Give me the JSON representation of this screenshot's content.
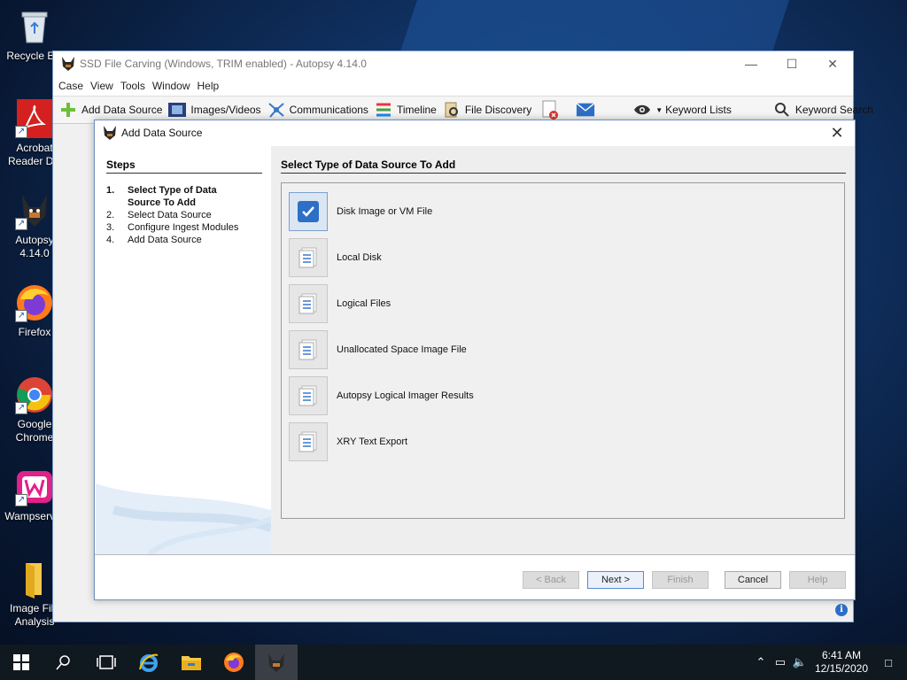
{
  "desktop": {
    "icons": [
      {
        "label": "Recycle Bin"
      },
      {
        "label": "Acrobat Reader DC"
      },
      {
        "label": "Autopsy 4.14.0"
      },
      {
        "label": "Firefox"
      },
      {
        "label": "Google Chrome"
      },
      {
        "label": "Wampserver"
      },
      {
        "label": "Image File Analysis"
      }
    ]
  },
  "window": {
    "title": "SSD File Carving (Windows, TRIM enabled) - Autopsy 4.14.0",
    "menu": [
      "Case",
      "View",
      "Tools",
      "Window",
      "Help"
    ],
    "toolbar": {
      "add_data_source": "Add Data Source",
      "images_videos": "Images/Videos",
      "communications": "Communications",
      "timeline": "Timeline",
      "file_discovery": "File Discovery",
      "keyword_lists": "Keyword Lists",
      "keyword_search": "Keyword Search"
    }
  },
  "dialog": {
    "title": "Add Data Source",
    "steps_heading": "Steps",
    "steps": [
      {
        "num": "1.",
        "label": "Select Type of Data Source To Add"
      },
      {
        "num": "2.",
        "label": "Select Data Source"
      },
      {
        "num": "3.",
        "label": "Configure Ingest Modules"
      },
      {
        "num": "4.",
        "label": "Add Data Source"
      }
    ],
    "content_heading": "Select Type of Data Source To Add",
    "options": [
      {
        "label": "Disk Image or VM File",
        "selected": true
      },
      {
        "label": "Local Disk"
      },
      {
        "label": "Logical Files"
      },
      {
        "label": "Unallocated Space Image File"
      },
      {
        "label": "Autopsy Logical Imager Results"
      },
      {
        "label": "XRY Text Export"
      }
    ],
    "buttons": {
      "back": "< Back",
      "next": "Next >",
      "finish": "Finish",
      "cancel": "Cancel",
      "help": "Help"
    }
  },
  "taskbar": {
    "time": "6:41 AM",
    "date": "12/15/2020"
  },
  "colors": {
    "accent": "#3a78c8",
    "desktop": "#0f2f5e"
  }
}
